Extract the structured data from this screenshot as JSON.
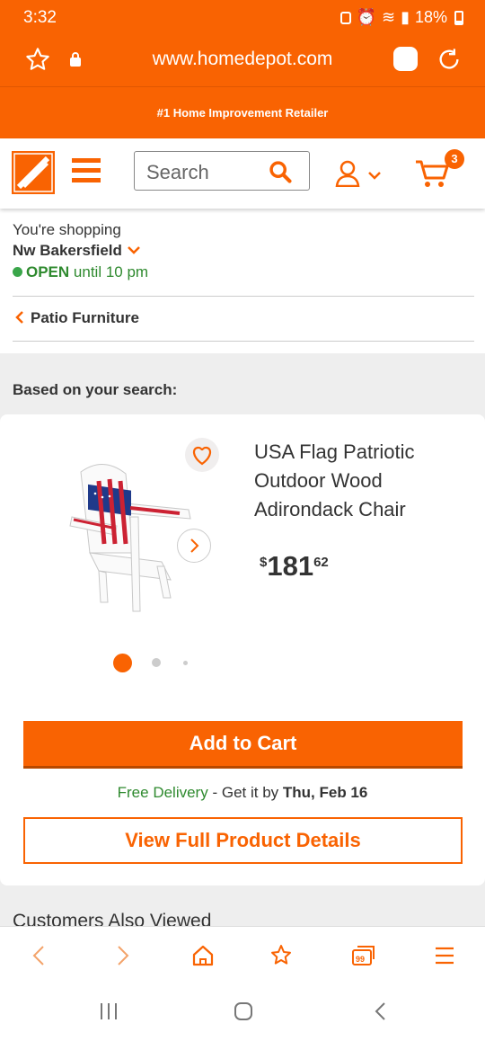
{
  "status": {
    "time": "3:32",
    "battery": "18%"
  },
  "browser": {
    "url": "www.homedepot.com"
  },
  "banner": {
    "text": "#1 Home Improvement Retailer"
  },
  "header": {
    "search_placeholder": "Search",
    "cart_count": "3"
  },
  "store": {
    "shopping_label": "You're shopping",
    "store_name": "Nw Bakersfield",
    "open_label": "OPEN",
    "hours": "until 10 pm"
  },
  "breadcrumb": {
    "label": "Patio Furniture"
  },
  "section": {
    "title": "Based on your search:"
  },
  "product": {
    "name": "USA Flag Patriotic Outdoor Wood Adirondack Chair",
    "price_symbol": "$",
    "price_dollars": "181",
    "price_cents": "62",
    "image_dots": 3,
    "active_dot": 0
  },
  "actions": {
    "add_to_cart": "Add to Cart",
    "delivery_free": "Free Delivery",
    "delivery_mid": " - Get it by ",
    "delivery_date": "Thu, Feb 16",
    "view_details": "View Full Product Details"
  },
  "next_section": {
    "title": "Customers Also Viewed"
  },
  "colors": {
    "brand": "#f96302",
    "open_green": "#2f8a2f"
  },
  "icons": [
    "star-icon",
    "lock-icon",
    "reload-icon",
    "menu-icon",
    "search-icon",
    "account-icon",
    "cart-icon",
    "heart-icon",
    "chevron-right-icon",
    "back-icon",
    "forward-icon",
    "home-icon",
    "bookmark-icon",
    "tabs-icon",
    "menu-lines-icon"
  ]
}
